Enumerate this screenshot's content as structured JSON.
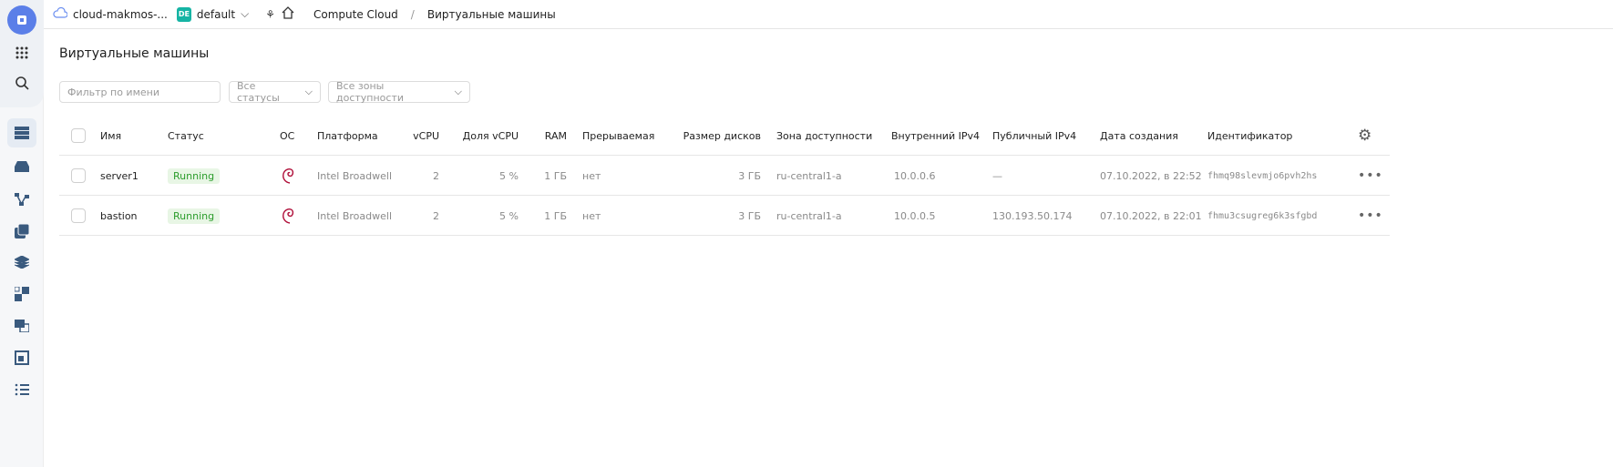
{
  "topbar": {
    "cloud": "cloud-makmos-...",
    "folder_badge": "DE",
    "folder": "default",
    "service": "Compute Cloud",
    "page": "Виртуальные машины"
  },
  "title": "Виртуальные машины",
  "filters": {
    "name_placeholder": "Фильтр по имени",
    "status": "Все статусы",
    "zone": "Все зоны доступности"
  },
  "columns": {
    "name": "Имя",
    "status": "Статус",
    "os": "ОС",
    "platform": "Платформа",
    "vcpu": "vCPU",
    "vcpu_share": "Доля vCPU",
    "ram": "RAM",
    "preemptible": "Прерываемая",
    "disk": "Размер дисков",
    "zone": "Зона доступности",
    "internal_ip": "Внутренний IPv4",
    "public_ip": "Публичный IPv4",
    "created": "Дата создания",
    "id": "Идентификатор"
  },
  "rows": [
    {
      "name": "server1",
      "status": "Running",
      "os": "debian",
      "platform": "Intel Broadwell",
      "vcpu": "2",
      "vcpu_share": "5 %",
      "ram": "1 ГБ",
      "preemptible": "нет",
      "disk": "3 ГБ",
      "zone": "ru-central1-a",
      "internal_ip": "10.0.0.6",
      "public_ip": "—",
      "created": "07.10.2022, в 22:52",
      "id": "fhmq98slevmjo6pvh2hs"
    },
    {
      "name": "bastion",
      "status": "Running",
      "os": "debian",
      "platform": "Intel Broadwell",
      "vcpu": "2",
      "vcpu_share": "5 %",
      "ram": "1 ГБ",
      "preemptible": "нет",
      "disk": "3 ГБ",
      "zone": "ru-central1-a",
      "internal_ip": "10.0.0.5",
      "public_ip": "130.193.50.174",
      "created": "07.10.2022, в 22:01",
      "id": "fhmu3csugreg6k3sfgbd"
    }
  ]
}
